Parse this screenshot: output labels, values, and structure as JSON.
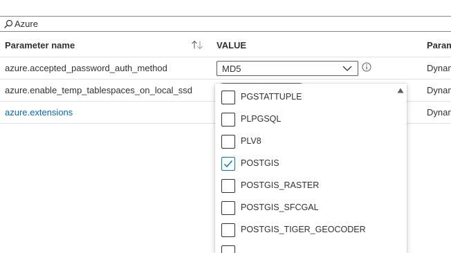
{
  "search": {
    "value": "Azure"
  },
  "table": {
    "columns": {
      "name": "Parameter name",
      "value": "VALUE",
      "type": "Param"
    },
    "rows": [
      {
        "name": "azure.accepted_password_auth_method",
        "value": "MD5",
        "type": "Dynam"
      },
      {
        "name": "azure.enable_temp_tablespaces_on_local_ssd",
        "type": "Dynam"
      },
      {
        "name": "azure.extensions",
        "type": "Dynam"
      }
    ]
  },
  "dropdown": {
    "options": [
      {
        "label": "PGSTATTUPLE",
        "checked": false
      },
      {
        "label": "PLPGSQL",
        "checked": false
      },
      {
        "label": "PLV8",
        "checked": false
      },
      {
        "label": "POSTGIS",
        "checked": true
      },
      {
        "label": "POSTGIS_RASTER",
        "checked": false
      },
      {
        "label": "POSTGIS_SFCGAL",
        "checked": false
      },
      {
        "label": "POSTGIS_TIGER_GEOCODER",
        "checked": false
      }
    ]
  },
  "colors": {
    "accent": "#0078d4",
    "link": "#0068c9",
    "text": "#323130",
    "border": "#e1dfdd"
  }
}
